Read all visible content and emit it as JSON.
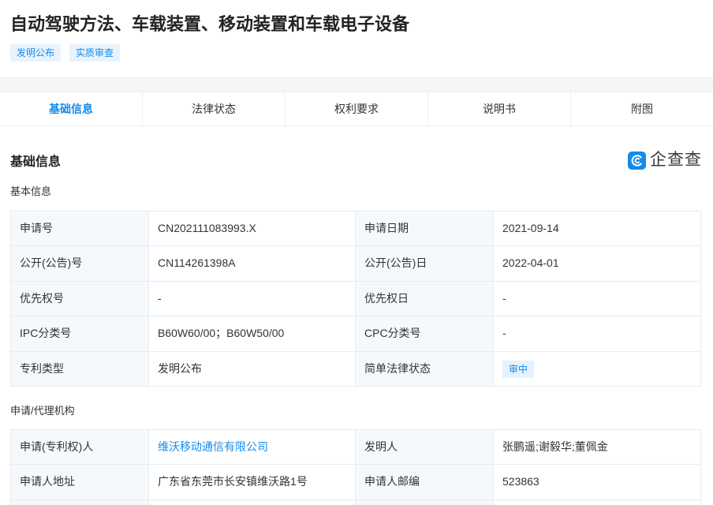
{
  "page": {
    "title": "自动驾驶方法、车载装置、移动装置和车载电子设备",
    "tags": [
      "发明公布",
      "实质审查"
    ]
  },
  "tabs": [
    {
      "label": "基础信息",
      "active": true
    },
    {
      "label": "法律状态",
      "active": false
    },
    {
      "label": "权利要求",
      "active": false
    },
    {
      "label": "说明书",
      "active": false
    },
    {
      "label": "附图",
      "active": false
    }
  ],
  "section": {
    "title": "基础信息"
  },
  "logo": {
    "text": "企查查",
    "icon": "qichacha-logo-icon"
  },
  "basic_info": {
    "heading": "基本信息",
    "rows": [
      {
        "label1": "申请号",
        "value1": "CN202111083993.X",
        "label2": "申请日期",
        "value2": "2021-09-14"
      },
      {
        "label1": "公开(公告)号",
        "value1": "CN114261398A",
        "label2": "公开(公告)日",
        "value2": "2022-04-01"
      },
      {
        "label1": "优先权号",
        "value1": "-",
        "label2": "优先权日",
        "value2": "-"
      },
      {
        "label1": "IPC分类号",
        "value1": "B60W60/00；B60W50/00",
        "label2": "CPC分类号",
        "value2": "-"
      },
      {
        "label1": "专利类型",
        "value1": "发明公布",
        "label2": "简单法律状态",
        "value2": "审中"
      }
    ]
  },
  "applicant_info": {
    "heading": "申请/代理机构",
    "rows": [
      {
        "label1": "申请(专利权)人",
        "value1": "维沃移动通信有限公司",
        "label2": "发明人",
        "value2": "张鹏遥;谢毅华;董佩金"
      },
      {
        "label1": "申请人地址",
        "value1": "广东省东莞市长安镇维沃路1号",
        "label2": "申请人邮编",
        "value2": "523863"
      }
    ]
  },
  "colors": {
    "accent": "#128bed",
    "tag_bg": "#e9f3fd",
    "label_bg": "#f6f9fc",
    "border": "#e4ecf3"
  }
}
